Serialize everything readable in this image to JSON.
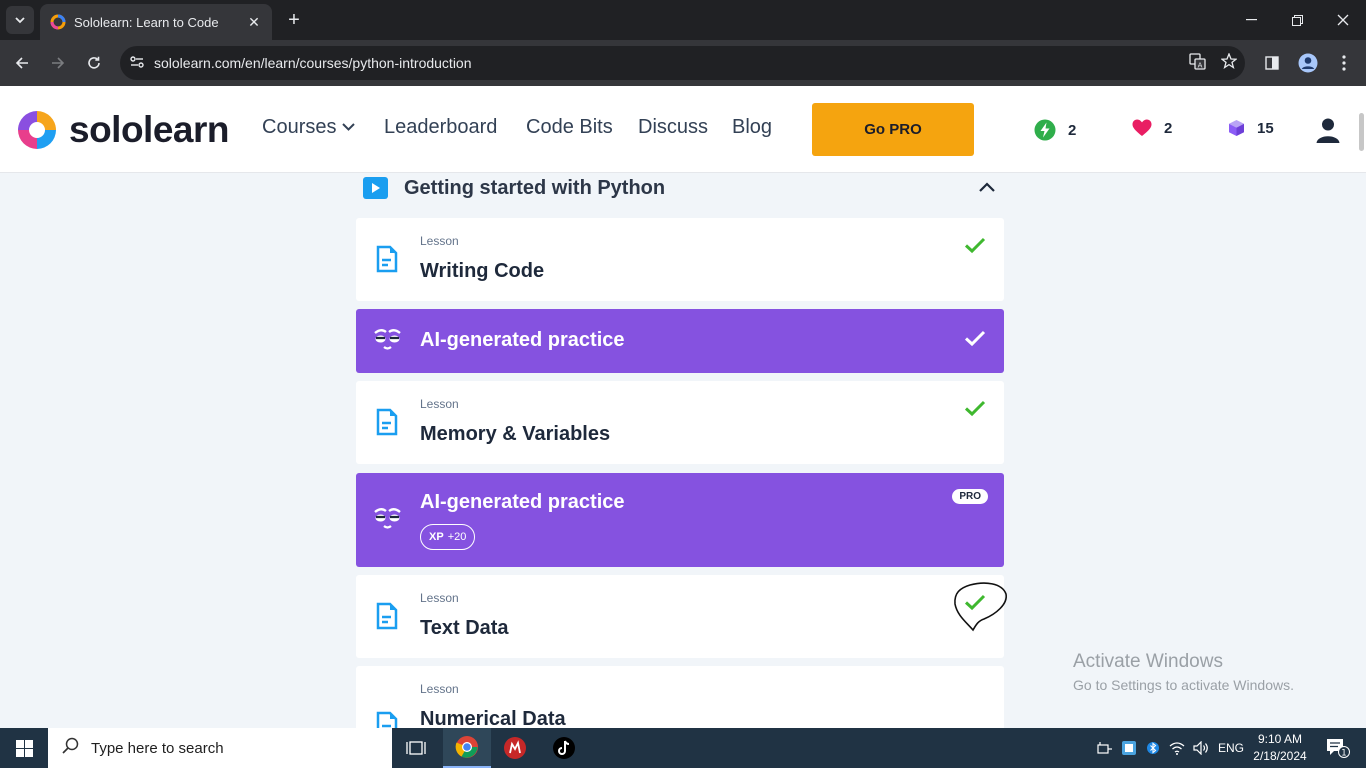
{
  "browser": {
    "tab_title": "Sololearn: Learn to Code",
    "url": "sololearn.com/en/learn/courses/python-introduction",
    "new_tab_symbol": "+",
    "tab_close_symbol": "✕"
  },
  "site": {
    "logo_text": "sololearn",
    "nav": {
      "courses": "Courses",
      "leaderboard": "Leaderboard",
      "code_bits": "Code Bits",
      "discuss": "Discuss",
      "blog": "Blog"
    },
    "go_pro": "Go PRO",
    "stats": {
      "streak": "2",
      "hearts": "2",
      "bits": "15"
    }
  },
  "module": {
    "title": "Getting started with Python",
    "items": [
      {
        "kind": "Lesson",
        "title": "Writing Code",
        "completed": true
      },
      {
        "kind": "",
        "title": "AI-generated practice",
        "completed": true
      },
      {
        "kind": "Lesson",
        "title": "Memory & Variables",
        "completed": true
      },
      {
        "kind": "",
        "title": "AI-generated practice",
        "badge": "PRO",
        "xp_label": "XP",
        "xp_value": "+20"
      },
      {
        "kind": "Lesson",
        "title": "Text Data",
        "completed": true
      },
      {
        "kind": "Lesson",
        "title": "Numerical Data"
      }
    ]
  },
  "watermark": {
    "line1": "Activate Windows",
    "line2": "Go to Settings to activate Windows."
  },
  "taskbar": {
    "search_placeholder": "Type here to search",
    "language": "ENG",
    "time": "9:10 AM",
    "date": "2/18/2024",
    "notification_count": "1"
  },
  "colors": {
    "accent_pro": "#f5a40f",
    "ai_card": "#8552e0",
    "check": "#3fb82f",
    "lesson_icon": "#1a9ef0"
  }
}
